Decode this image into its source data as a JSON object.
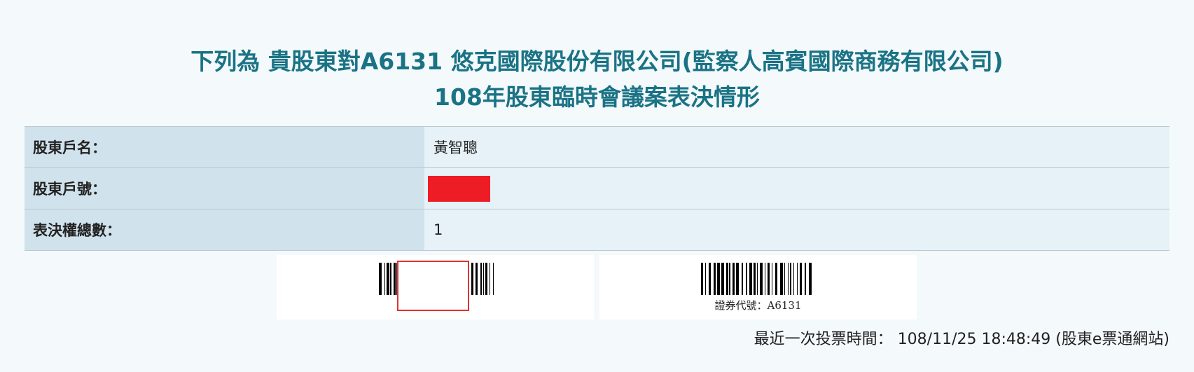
{
  "header": {
    "title_line1": "下列為 貴股東對A6131 悠克國際股份有限公司(監察人高賓國際商務有限公司)",
    "title_line2": "108年股東臨時會議案表決情形"
  },
  "shareholder": {
    "name_label": "股東戶名：",
    "name_value": "黃智聰",
    "account_label": "股東戶號：",
    "account_value": "",
    "votes_label": "表決權總數：",
    "votes_value": "1"
  },
  "barcodes": {
    "right_caption": "證券代號：A6131"
  },
  "vote_time": {
    "label": "最近一次投票時間：",
    "value": "108/11/25 18:48:49 (股東e票通網站)"
  },
  "colors": {
    "title": "#1a7385",
    "label_bg": "#d0e2ec",
    "value_bg": "#e6f2f7",
    "redaction": "#ee1c25"
  }
}
